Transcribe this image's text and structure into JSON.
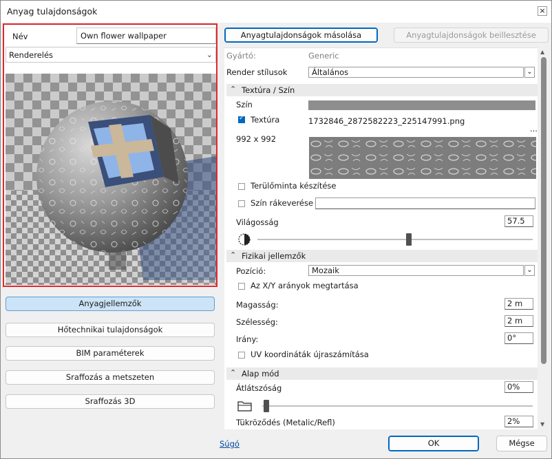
{
  "window": {
    "title": "Anyag tulajdonságok",
    "close_glyph": "×"
  },
  "left": {
    "name_label": "Név",
    "name_value": "Own flower wallpaper",
    "render_select": "Renderelés",
    "buttons": [
      "Anyagjellemzők",
      "Hőtechnikai tulajdonságok",
      "BIM paraméterek",
      "Sraffozás a metszeten",
      "Sraffozás 3D"
    ]
  },
  "toolbar": {
    "copy_label": "Anyagtulajdonságok másolása",
    "paste_label": "Anyagtulajdonságok beillesztése"
  },
  "props": {
    "manufacturer_label": "Gyártó:",
    "manufacturer_value": "Generic",
    "render_style_label": "Render stílusok",
    "render_style_value": "Általános",
    "section_texture": "Textúra / Szín",
    "color_label": "Szín",
    "texture_label": "Textúra",
    "texture_file": "1732846_2872582223_225147991.png",
    "texture_size": "992 x 992",
    "more_dots": "...",
    "area_pattern_label": "Terülőminta készítése",
    "color_mix_label": "Szín rákeverése",
    "brightness_label": "Világosság",
    "brightness_value": "57.5",
    "brightness_level": 0.55,
    "section_physical": "Fizikai jellemzők",
    "position_label": "Pozíció:",
    "position_value": "Mozaik",
    "keep_xy_label": "Az X/Y arányok megtartása",
    "height_label": "Magasság:",
    "height_value": "2 m",
    "width_label": "Szélesség:",
    "width_value": "2 m",
    "direction_label": "Irány:",
    "direction_value": "0°",
    "uv_label": "UV koordináták újraszámítása",
    "section_base": "Alap mód",
    "transparency_label": "Átlátszóság",
    "transparency_value": "0%",
    "reflection_label": "Tükröződés (Metalic/Refl)",
    "reflection_value": "2%"
  },
  "footer": {
    "help": "Súgó",
    "ok": "OK",
    "cancel": "Mégse"
  },
  "colors": {
    "accent": "#0067c0",
    "highlight_border": "#e0262c",
    "active_button": "#cce4f7"
  }
}
